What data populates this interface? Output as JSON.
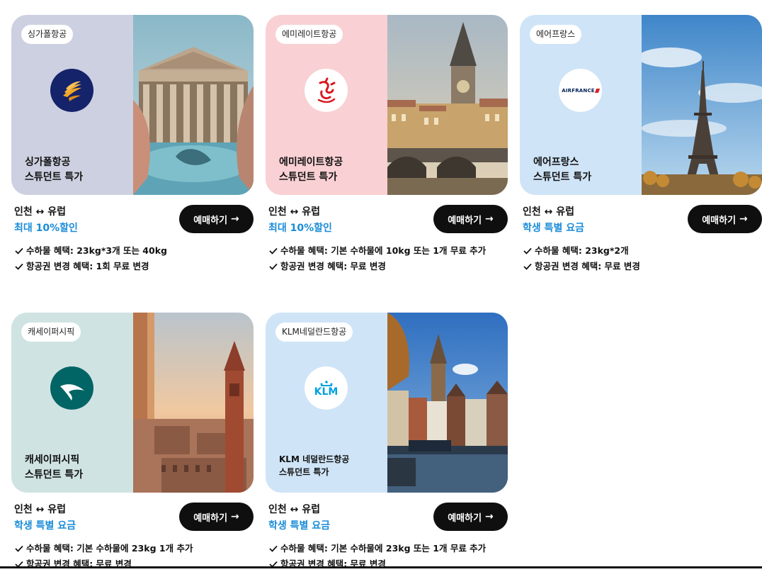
{
  "cards": [
    {
      "tag": "싱가폴항공",
      "title_line1": "싱가폴항공",
      "title_line2": "스튜던트 특가",
      "route": "인천 ↔ 유럽",
      "discount": "최대 10%할인",
      "button_label": "예매하기",
      "benefits": [
        "수하물 혜택: 23kg*3개 또는 40kg",
        "항공권 변경 혜택: 1회 무료 변경"
      ],
      "bg_color": "#ccd0e0",
      "logo_icon": "singapore-airlines-logo-icon"
    },
    {
      "tag": "에미레이트항공",
      "title_line1": "에미레이트항공",
      "title_line2": "스튜던트 특가",
      "route": "인천 ↔ 유럽",
      "discount": "최대 10%할인",
      "button_label": "예매하기",
      "benefits": [
        "수하물 혜택: 기본 수하물에 10kg 또는 1개 무료 추가",
        "항공권 변경 혜택: 무료 변경"
      ],
      "bg_color": "#f9d0d3",
      "logo_icon": "emirates-logo-icon"
    },
    {
      "tag": "에어프랑스",
      "title_line1": "에어프랑스",
      "title_line2": "스튜던트 특가",
      "route": "인천 ↔ 유럽",
      "discount": "학생 특별 요금",
      "button_label": "예매하기",
      "benefits": [
        "수하물 혜택: 23kg*2개",
        "항공권 변경 혜택: 무료 변경"
      ],
      "bg_color": "#cfe4f7",
      "logo_icon": "air-france-logo-icon",
      "logo_text": "AIRFRANCE"
    },
    {
      "tag": "캐세이퍼시픽",
      "title_line1": "캐세이퍼시픽",
      "title_line2": "스튜던트 특가",
      "route": "인천 ↔ 유럽",
      "discount": "학생 특별 요금",
      "button_label": "예매하기",
      "benefits": [
        "수하물 혜택: 기본 수하물에 23kg 1개 추가",
        "항공권 변경 혜택: 무료 변경"
      ],
      "bg_color": "#d0e3e3",
      "logo_icon": "cathay-pacific-logo-icon"
    },
    {
      "tag": "KLM네덜란드항공",
      "title_line1": "KLM 네덜란드항공",
      "title_line2": "스튜던트 특가",
      "route": "인천 ↔ 유럽",
      "discount": "학생 특별 요금",
      "button_label": "예매하기",
      "benefits": [
        "수하물 혜택: 기본 수하물에 23kg 또는 1개 무료 추가",
        "항공권 변경 혜택: 무료 변경"
      ],
      "bg_color": "#cfe4f7",
      "logo_icon": "klm-logo-icon",
      "logo_text": "KLM"
    }
  ],
  "colors": {
    "accent": "#1a8cd8",
    "button": "#0f0f0f"
  }
}
